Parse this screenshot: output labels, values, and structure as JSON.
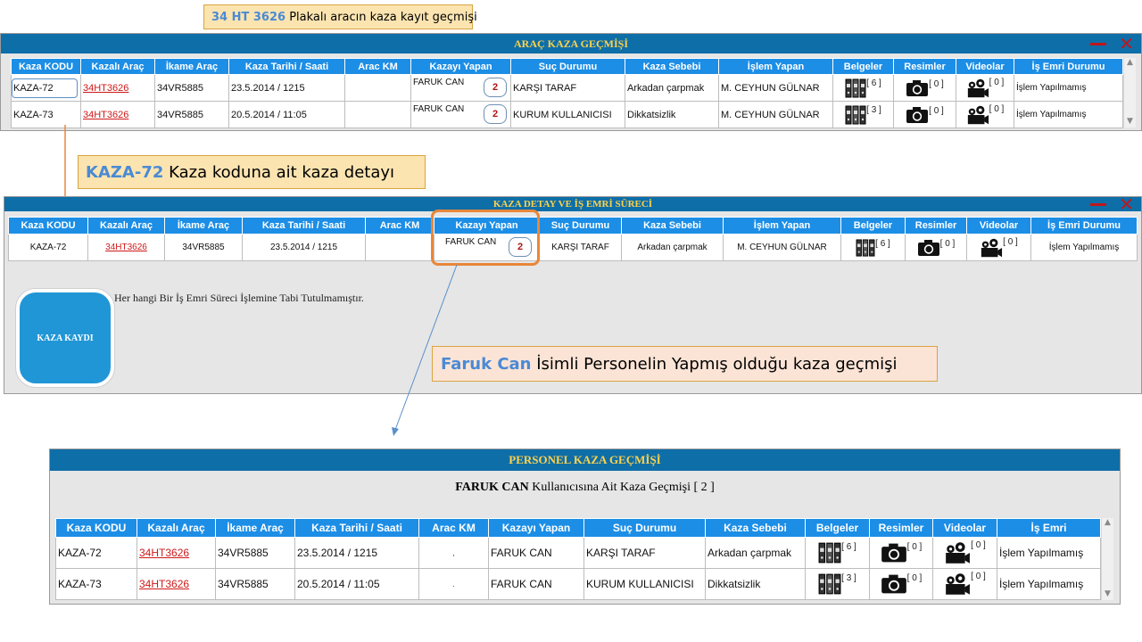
{
  "callouts": {
    "plate": {
      "highlight": "34 HT 3626",
      "text": " Plakalı aracın kaza kayıt geçmişi"
    },
    "code": {
      "highlight": "KAZA-72",
      "text": " Kaza koduna ait kaza detayı"
    },
    "person": {
      "highlight": "Faruk Can",
      "text": " İsimli Personelin Yapmış olduğu kaza geçmişi"
    }
  },
  "panel1": {
    "title": "ARAÇ KAZA GEÇMİŞİ",
    "headers": [
      "Kaza KODU",
      "Kazalı Araç",
      "İkame Araç",
      "Kaza Tarihi / Saati",
      "Arac KM",
      "Kazayı Yapan",
      "Suç Durumu",
      "Kaza Sebebi",
      "İşlem Yapan",
      "Belgeler",
      "Resimler",
      "Videolar",
      "İş Emri Durumu"
    ],
    "rows": [
      {
        "code": "KAZA-72",
        "vehicle": "34HT3626",
        "replacement": "34VR5885",
        "date": "23.5.2014 / 1215",
        "km": "",
        "driver": "FARUK CAN",
        "driver_count": "2",
        "fault": "KARŞI TARAF",
        "cause": "Arkadan çarpmak",
        "operator": "M. CEYHUN GÜLNAR",
        "docs": "[ 6 ]",
        "photos": "[ 0 ]",
        "videos": "[ 0 ]",
        "status": "İşlem Yapılmamış"
      },
      {
        "code": "KAZA-73",
        "vehicle": "34HT3626",
        "replacement": "34VR5885",
        "date": "20.5.2014 / 11:05",
        "km": "",
        "driver": "FARUK CAN",
        "driver_count": "2",
        "fault": "KURUM KULLANICISI",
        "cause": "Dikkatsizlik",
        "operator": "M. CEYHUN GÜLNAR",
        "docs": "[ 3 ]",
        "photos": "[ 0 ]",
        "videos": "[ 0 ]",
        "status": "İşlem Yapılmamış"
      }
    ]
  },
  "panel2": {
    "title": "KAZA DETAY VE İŞ EMRİ SÜRECİ",
    "headers": [
      "Kaza KODU",
      "Kazalı Araç",
      "İkame Araç",
      "Kaza Tarihi / Saati",
      "Arac KM",
      "Kazayı Yapan",
      "Suç Durumu",
      "Kaza Sebebi",
      "İşlem Yapan",
      "Belgeler",
      "Resimler",
      "Videolar",
      "İş Emri Durumu"
    ],
    "row": {
      "code": "KAZA-72",
      "vehicle": "34HT3626",
      "replacement": "34VR5885",
      "date": "23.5.2014 / 1215",
      "km": "",
      "driver": "FARUK CAN",
      "driver_count": "2",
      "fault": "KARŞI TARAF",
      "cause": "Arkadan çarpmak",
      "operator": "M. CEYHUN GÜLNAR",
      "docs": "[ 6 ]",
      "photos": "[ 0 ]",
      "videos": "[ 0 ]",
      "status": "İşlem Yapılmamış"
    },
    "message": "Her hangi Bir İş Emri Süreci İşlemine Tabi Tutulmamıştır.",
    "button_label": "KAZA KAYDI"
  },
  "panel3": {
    "title": "PERSONEL KAZA GEÇMİŞİ",
    "subtitle_name": "FARUK CAN",
    "subtitle_text": " Kullanıcısına Ait Kaza Geçmişi [ 2 ]",
    "headers": [
      "Kaza KODU",
      "Kazalı Araç",
      "İkame Araç",
      "Kaza Tarihi / Saati",
      "Arac KM",
      "Kazayı Yapan",
      "Suç Durumu",
      "Kaza Sebebi",
      "Belgeler",
      "Resimler",
      "Videolar",
      "İş Emri"
    ],
    "rows": [
      {
        "code": "KAZA-72",
        "vehicle": "34HT3626",
        "replacement": "34VR5885",
        "date": "23.5.2014 / 1215",
        "km": ",",
        "driver": "FARUK CAN",
        "fault": "KARŞI TARAF",
        "cause": "Arkadan çarpmak",
        "docs": "[ 6 ]",
        "photos": "[ 0 ]",
        "videos": "[ 0 ]",
        "status": "İşlem Yapılmamış"
      },
      {
        "code": "KAZA-73",
        "vehicle": "34HT3626",
        "replacement": "34VR5885",
        "date": "20.5.2014 / 11:05",
        "km": ".",
        "driver": "FARUK CAN",
        "fault": "KURUM KULLANICISI",
        "cause": "Dikkatsizlik",
        "docs": "[ 3 ]",
        "photos": "[ 0 ]",
        "videos": "[ 0 ]",
        "status": "İşlem Yapılmamış"
      }
    ]
  },
  "colors": {
    "header_blue": "#1c8ee6",
    "title_bar": "#0e6ea8",
    "title_text": "#ffd24a",
    "link_red": "#d01818",
    "highlight_orange": "#e8873a",
    "callout_blue": "#4a8ad4"
  },
  "icons": {
    "documents": "binders-icon",
    "photos": "camera-icon",
    "videos": "video-camera-icon",
    "minimize": "minimize-icon",
    "close": "close-icon"
  }
}
